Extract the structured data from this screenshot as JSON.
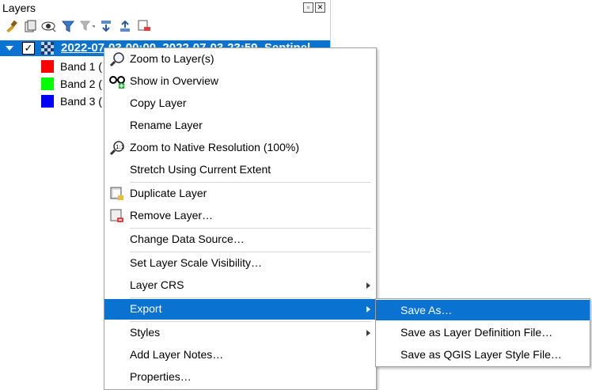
{
  "panel": {
    "title": "Layers",
    "window_buttons": [
      "restore",
      "close"
    ],
    "toolbar_icons": [
      "open-layer-styling-icon",
      "add-group-icon",
      "manage-visibility-icon",
      "filter-legend-icon",
      "filter-by-expression-icon",
      "expand-all-icon",
      "collapse-all-icon",
      "remove-layer-icon"
    ]
  },
  "layer": {
    "name": "2022-07-03-00:00_2022-07-03-23:59_Sentinel",
    "checked": "✓",
    "bands": [
      {
        "label": "Band 1 (",
        "color": "#ff0000"
      },
      {
        "label": "Band 2 (",
        "color": "#00ff00"
      },
      {
        "label": "Band 3 (",
        "color": "#0000ff"
      }
    ]
  },
  "context_menu": {
    "items": [
      {
        "label": "Zoom to Layer(s)",
        "icon": "zoom-to-layer-icon"
      },
      {
        "label": "Show in Overview",
        "icon": "show-overview-icon"
      },
      {
        "label": "Copy Layer"
      },
      {
        "label": "Rename Layer"
      },
      {
        "label": "Zoom to Native Resolution (100%)",
        "icon": "zoom-native-icon"
      },
      {
        "label": "Stretch Using Current Extent"
      },
      {
        "label": "Duplicate Layer",
        "icon": "duplicate-layer-icon"
      },
      {
        "label": "Remove Layer…",
        "icon": "remove-layer-icon"
      },
      {
        "label": "Change Data Source…"
      },
      {
        "label": "Set Layer Scale Visibility…"
      },
      {
        "label": "Layer CRS",
        "submenu": true
      },
      {
        "label": "Export",
        "submenu": true,
        "highlighted": true
      },
      {
        "label": "Styles",
        "submenu": true
      },
      {
        "label": "Add Layer Notes…"
      },
      {
        "label": "Properties…"
      }
    ]
  },
  "export_submenu": {
    "items": [
      {
        "label": "Save As…",
        "highlighted": true
      },
      {
        "label": "Save as Layer Definition File…"
      },
      {
        "label": "Save as QGIS Layer Style File…"
      }
    ]
  },
  "colors": {
    "highlight": "#0a72d1"
  }
}
